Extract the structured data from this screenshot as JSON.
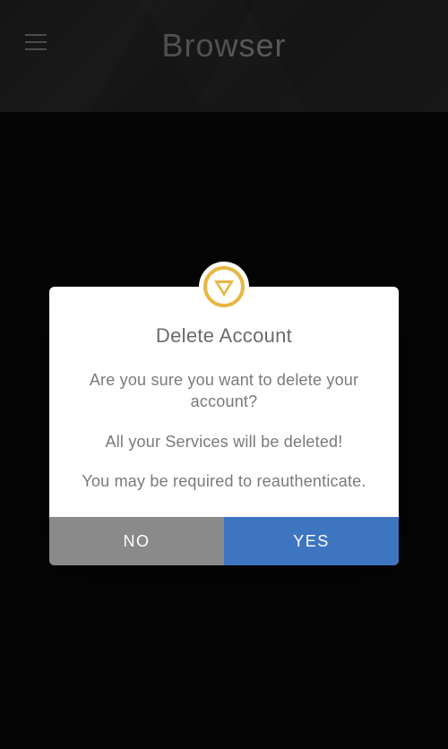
{
  "header": {
    "title": "Browser"
  },
  "dialog": {
    "title": "Delete Account",
    "line1": "Are you sure you want to delete your account?",
    "line2": "All your Services will be deleted!",
    "line3": "You may be required to reauthenticate.",
    "no_label": "NO",
    "yes_label": "YES"
  }
}
